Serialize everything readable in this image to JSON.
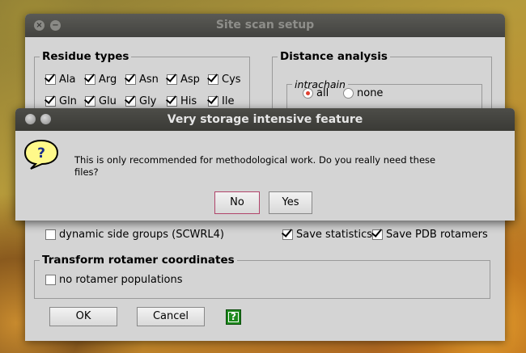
{
  "main_window": {
    "title": "Site scan setup",
    "residue_types": {
      "legend": "Residue types",
      "row1": [
        {
          "label": "Ala",
          "checked": true
        },
        {
          "label": "Arg",
          "checked": true
        },
        {
          "label": "Asn",
          "checked": true
        },
        {
          "label": "Asp",
          "checked": true
        },
        {
          "label": "Cys",
          "checked": true
        }
      ],
      "row2": [
        {
          "label": "Gln",
          "checked": true
        },
        {
          "label": "Glu",
          "checked": true
        },
        {
          "label": "Gly",
          "checked": true
        },
        {
          "label": "His",
          "checked": true
        },
        {
          "label": "Ile",
          "checked": true
        }
      ]
    },
    "distance_analysis": {
      "legend": "Distance analysis",
      "intrachain": {
        "legend": "intrachain",
        "options": [
          {
            "label": "all",
            "selected": true
          },
          {
            "label": "none",
            "selected": false
          }
        ]
      }
    },
    "options": {
      "dynamic_side_groups": {
        "label": "dynamic side groups (SCWRL4)",
        "checked": false
      },
      "save_statistics": {
        "label": "Save statistics",
        "checked": true
      },
      "save_pdb_rotamers": {
        "label": "Save PDB rotamers",
        "checked": true
      }
    },
    "transform": {
      "legend": "Transform rotamer coordinates",
      "no_rotamer_populations": {
        "label": "no rotamer populations",
        "checked": false
      }
    },
    "buttons": {
      "ok": "OK",
      "cancel": "Cancel",
      "help": "?"
    }
  },
  "dialog": {
    "title": "Very storage intensive feature",
    "icon": "question-icon",
    "message": "This is only recommended for methodological work. Do you really need these files?",
    "buttons": {
      "no": "No",
      "yes": "Yes"
    }
  },
  "colors": {
    "accent_radio": "#e04030",
    "help_button": "#1d8a1d",
    "focus_border": "#b0446a"
  }
}
